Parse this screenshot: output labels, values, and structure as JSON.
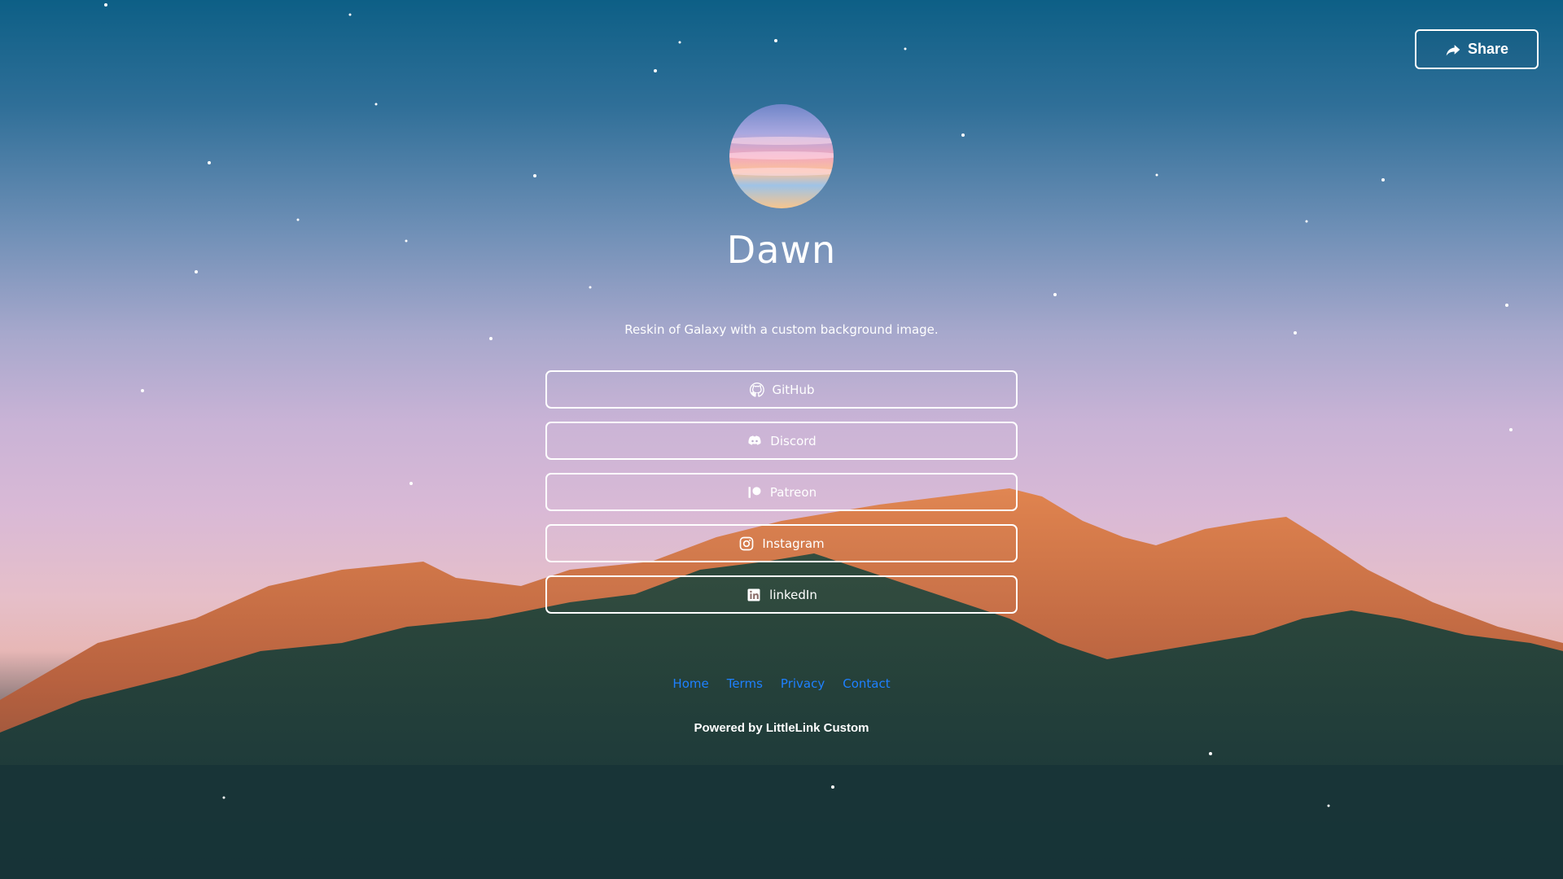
{
  "share": {
    "label": "Share",
    "icon": "share-icon"
  },
  "profile": {
    "name": "Dawn",
    "description": "Reskin of Galaxy with a custom background image."
  },
  "links": [
    {
      "label": "GitHub",
      "icon": "github-icon"
    },
    {
      "label": "Discord",
      "icon": "discord-icon"
    },
    {
      "label": "Patreon",
      "icon": "patreon-icon"
    },
    {
      "label": "Instagram",
      "icon": "instagram-icon"
    },
    {
      "label": "linkedIn",
      "icon": "linkedin-icon"
    }
  ],
  "footer": {
    "links": [
      "Home",
      "Terms",
      "Privacy",
      "Contact"
    ],
    "powered_by": "Powered by LittleLink Custom"
  },
  "colors": {
    "footer_link": "#1e80ff",
    "sky_top": "#0d5f86",
    "sky_mid": "#c9b3d6",
    "mountain_lit": "#c96a3f",
    "forest": "#1f3f3c"
  }
}
